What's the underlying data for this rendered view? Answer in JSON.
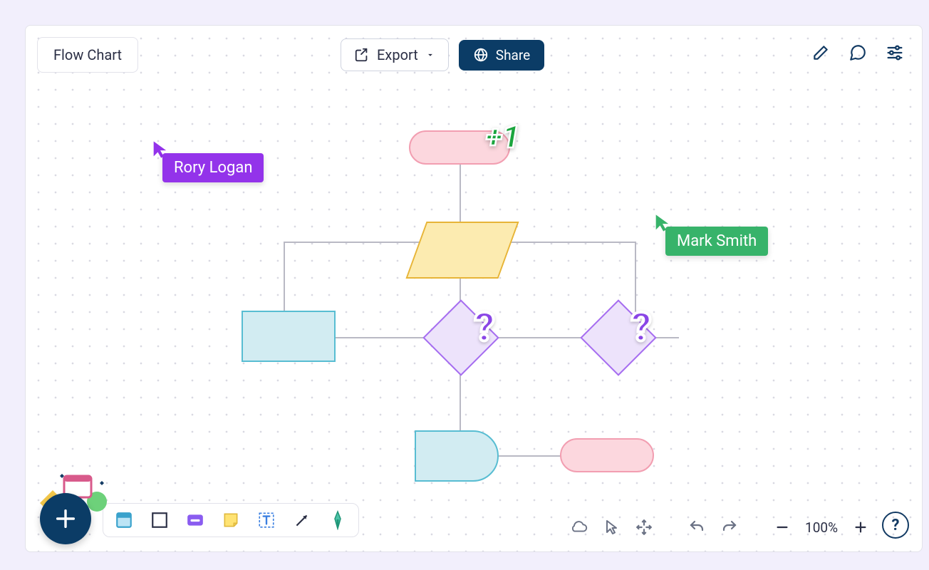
{
  "header": {
    "title": "Flow Chart",
    "export_label": "Export",
    "share_label": "Share"
  },
  "collaborators": {
    "purple": {
      "name": "Rory Logan",
      "color": "#9333ea"
    },
    "green": {
      "name": "Mark Smith",
      "color": "#37b36a"
    }
  },
  "reactions": {
    "plus_one": "+1",
    "question": "?"
  },
  "zoom": {
    "level": "100%"
  },
  "help": {
    "label": "?"
  }
}
